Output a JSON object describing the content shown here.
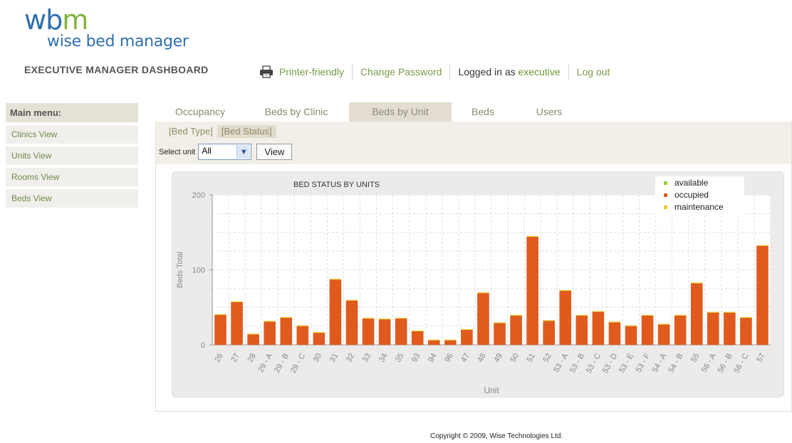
{
  "logo": {
    "mark_w": "w",
    "mark_b": "b",
    "mark_m": "m",
    "text": "wise bed manager"
  },
  "header": {
    "title": "EXECUTIVE MANAGER DASHBOARD"
  },
  "topnav": {
    "printer": "Printer-friendly",
    "change_password": "Change Password",
    "logged_prefix": "Logged in as",
    "username": "executive",
    "logout": "Log out"
  },
  "sidebar": {
    "heading": "Main menu:",
    "items": [
      {
        "label": "Clinics View"
      },
      {
        "label": "Units View"
      },
      {
        "label": "Rooms View"
      },
      {
        "label": "Beds View"
      }
    ]
  },
  "tabs": [
    {
      "label": "Occupancy"
    },
    {
      "label": "Beds by Clinic"
    },
    {
      "label": "Beds by Unit"
    },
    {
      "label": "Beds"
    },
    {
      "label": "Users"
    }
  ],
  "subtabs": [
    {
      "label": "[Bed Type]"
    },
    {
      "label": "[Bed Status]"
    }
  ],
  "filter": {
    "label": "Select unit",
    "value": "All",
    "button": "View"
  },
  "footer": "Copyright © 2009, Wise Technologies Ltd.",
  "colors": {
    "occupied": "#e05a1e",
    "available": "#9bcf2a",
    "maintenance": "#e8cf20"
  },
  "chart_data": {
    "type": "bar",
    "stacked": true,
    "title": "BED STATUS BY UNITS",
    "xlabel": "Unit",
    "ylabel": "Beds Total",
    "ylim": [
      0,
      200
    ],
    "yticks": [
      0,
      100,
      200
    ],
    "grid": true,
    "legend_position": "top-right",
    "categories": [
      "26",
      "27",
      "28",
      "29 - A",
      "29 - B",
      "29 - C",
      "30",
      "31",
      "32",
      "33",
      "34",
      "35",
      "93",
      "94",
      "96",
      "47",
      "48",
      "49",
      "50",
      "51",
      "52",
      "53 - A",
      "53 - B",
      "53 - C",
      "53 - D",
      "53 - E",
      "53 - F",
      "54 - A",
      "54 - B",
      "55",
      "56 - A",
      "56 - B",
      "56 - C",
      "57"
    ],
    "series": [
      {
        "name": "available",
        "values": [
          0,
          0,
          0,
          0,
          0,
          0,
          0,
          0,
          0,
          0,
          0,
          0,
          0,
          0,
          0,
          0,
          0,
          0,
          0,
          0,
          0,
          0,
          0,
          0,
          0,
          0,
          0,
          0,
          0,
          0,
          0,
          0,
          0,
          0
        ]
      },
      {
        "name": "occupied",
        "values": [
          40,
          57,
          14,
          31,
          36,
          25,
          16,
          87,
          59,
          35,
          34,
          35,
          18,
          6,
          6,
          20,
          69,
          29,
          39,
          144,
          32,
          72,
          39,
          44,
          30,
          25,
          39,
          27,
          39,
          82,
          43,
          43,
          36,
          132
        ]
      },
      {
        "name": "maintenance",
        "values": [
          1,
          1,
          1,
          1,
          1,
          1,
          1,
          1,
          1,
          1,
          1,
          1,
          1,
          1,
          1,
          1,
          1,
          1,
          1,
          1,
          1,
          1,
          1,
          1,
          1,
          1,
          1,
          1,
          1,
          1,
          1,
          1,
          1,
          1
        ]
      }
    ]
  }
}
